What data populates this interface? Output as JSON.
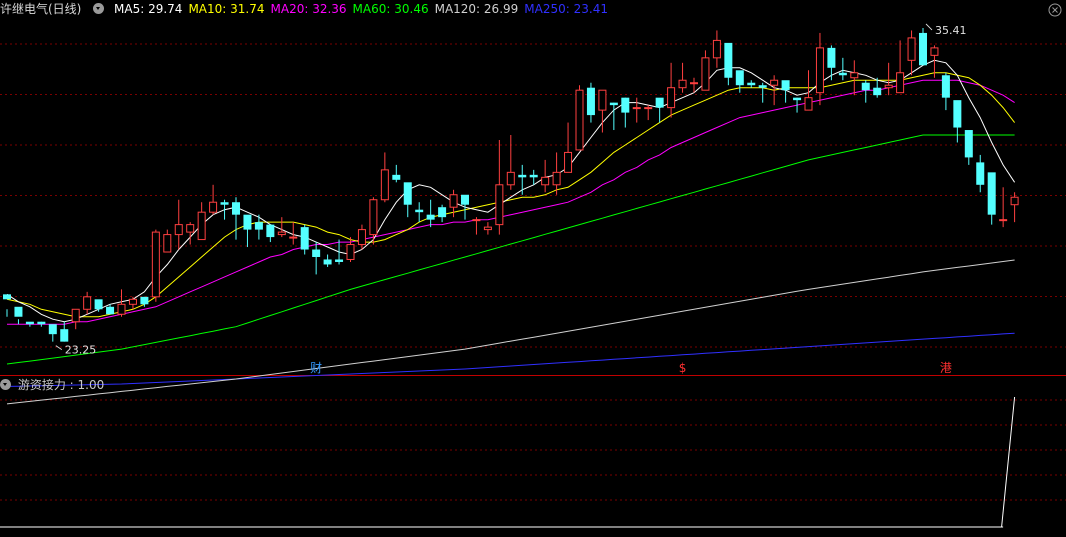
{
  "header": {
    "stock_name": "许继电气(日线)",
    "ma": [
      {
        "label": "MA5: 29.74",
        "color": "#ffffff"
      },
      {
        "label": "MA10: 31.74",
        "color": "#ffff00"
      },
      {
        "label": "MA20: 32.36",
        "color": "#ff00ff"
      },
      {
        "label": "MA60: 30.46",
        "color": "#00ff00"
      },
      {
        "label": "MA120: 26.99",
        "color": "#d0d0d0"
      },
      {
        "label": "MA250: 23.41",
        "color": "#3030ff"
      }
    ]
  },
  "indicator": {
    "label": "游资接力",
    "value_text": ": 1.00"
  },
  "annotations": {
    "high_label": "35.41",
    "low_label": "23.25",
    "markers": [
      {
        "text": "财",
        "color": "#3399ff",
        "x_index": 27
      },
      {
        "text": "$",
        "color": "#ff3030",
        "x_index": 59
      },
      {
        "text": "港",
        "color": "#ff3030",
        "x_index": 82
      }
    ]
  },
  "colors": {
    "up": "#ff4040",
    "down": "#54ffff",
    "grid": "#7a0000",
    "separator": "#c00000"
  },
  "chart_data": {
    "type": "candlestick",
    "price_range": [
      22.0,
      36.3
    ],
    "candles": [
      [
        25.2,
        25.0,
        24.6,
        24.3
      ],
      [
        24.7,
        24.3,
        24.2,
        24.0
      ],
      [
        24.1,
        24.0,
        24.0,
        23.9
      ],
      [
        24.1,
        24.0,
        24.1,
        23.9
      ],
      [
        24.0,
        23.6,
        23.9,
        23.3
      ],
      [
        23.8,
        23.3,
        24.1,
        23.3
      ],
      [
        24.1,
        24.6,
        24.6,
        23.8
      ],
      [
        24.6,
        25.1,
        25.3,
        24.4
      ],
      [
        25.0,
        24.6,
        24.9,
        24.5
      ],
      [
        24.7,
        24.4,
        24.8,
        24.4
      ],
      [
        24.4,
        24.8,
        25.4,
        24.3
      ],
      [
        24.8,
        25.0,
        25.1,
        24.6
      ],
      [
        25.1,
        24.8,
        25.1,
        24.7
      ],
      [
        25.1,
        27.7,
        27.8,
        24.9
      ],
      [
        26.9,
        27.6,
        27.8,
        26.9
      ],
      [
        27.6,
        28.0,
        29.0,
        27.0
      ],
      [
        27.7,
        28.0,
        28.1,
        27.2
      ],
      [
        27.4,
        28.5,
        28.9,
        27.4
      ],
      [
        28.5,
        28.9,
        29.6,
        28.4
      ],
      [
        28.9,
        28.8,
        29.0,
        28.2
      ],
      [
        28.9,
        28.4,
        29.1,
        27.4
      ],
      [
        28.4,
        27.8,
        28.3,
        27.1
      ],
      [
        28.1,
        27.8,
        28.4,
        27.4
      ],
      [
        28.0,
        27.5,
        28.0,
        27.3
      ],
      [
        27.6,
        27.7,
        28.3,
        27.5
      ],
      [
        27.5,
        27.5,
        28.1,
        27.2
      ],
      [
        27.9,
        27.0,
        28.0,
        26.8
      ],
      [
        27.0,
        26.7,
        27.3,
        26.0
      ],
      [
        26.6,
        26.4,
        26.8,
        26.3
      ],
      [
        26.6,
        26.5,
        27.4,
        26.4
      ],
      [
        26.6,
        27.2,
        27.5,
        26.5
      ],
      [
        27.2,
        27.8,
        28.0,
        27.0
      ],
      [
        27.6,
        29.0,
        29.1,
        27.2
      ],
      [
        29.0,
        30.2,
        30.9,
        28.9
      ],
      [
        30.0,
        29.8,
        30.4,
        29.7
      ],
      [
        29.7,
        28.8,
        29.6,
        28.3
      ],
      [
        28.6,
        28.5,
        28.9,
        28.1
      ],
      [
        28.4,
        28.2,
        29.0,
        27.9
      ],
      [
        28.7,
        28.3,
        28.8,
        28.1
      ],
      [
        28.7,
        29.2,
        29.4,
        28.3
      ],
      [
        29.2,
        28.8,
        29.1,
        28.2
      ],
      [
        28.2,
        28.2,
        28.3,
        27.6
      ],
      [
        27.8,
        27.9,
        28.1,
        27.6
      ],
      [
        28.0,
        29.6,
        31.4,
        27.6
      ],
      [
        29.6,
        30.1,
        31.6,
        29.4
      ],
      [
        30.0,
        29.9,
        30.4,
        29.2
      ],
      [
        30.0,
        29.9,
        30.2,
        29.6
      ],
      [
        29.6,
        29.9,
        30.6,
        29.3
      ],
      [
        29.6,
        30.1,
        30.9,
        29.2
      ],
      [
        30.1,
        30.9,
        32.1,
        30.1
      ],
      [
        31.0,
        33.4,
        33.6,
        31.8
      ],
      [
        33.5,
        32.4,
        33.7,
        32.1
      ],
      [
        32.6,
        33.4,
        33.2,
        31.7
      ],
      [
        32.9,
        32.8,
        32.9,
        31.8
      ],
      [
        33.1,
        32.5,
        33.1,
        31.9
      ],
      [
        32.7,
        32.7,
        33.1,
        32.1
      ],
      [
        32.7,
        32.7,
        32.8,
        32.2
      ],
      [
        33.1,
        32.7,
        32.8,
        32.1
      ],
      [
        32.7,
        33.5,
        34.5,
        32.3
      ],
      [
        33.5,
        33.8,
        34.5,
        33.3
      ],
      [
        33.7,
        33.7,
        33.9,
        33.3
      ],
      [
        33.4,
        34.7,
        35.0,
        33.5
      ],
      [
        34.7,
        35.4,
        35.8,
        34.3
      ],
      [
        35.3,
        33.9,
        34.6,
        33.6
      ],
      [
        34.2,
        33.6,
        34.1,
        33.3
      ],
      [
        33.7,
        33.6,
        33.8,
        33.5
      ],
      [
        33.6,
        33.5,
        33.7,
        32.9
      ],
      [
        33.6,
        33.8,
        34.0,
        32.8
      ],
      [
        33.8,
        33.4,
        33.6,
        32.9
      ],
      [
        33.1,
        33.0,
        33.1,
        32.5
      ],
      [
        32.6,
        33.1,
        34.2,
        32.6
      ],
      [
        33.3,
        35.1,
        35.7,
        32.8
      ],
      [
        35.1,
        34.3,
        35.2,
        33.8
      ],
      [
        34.1,
        34.0,
        34.7,
        33.8
      ],
      [
        33.9,
        34.1,
        34.6,
        33.2
      ],
      [
        33.7,
        33.4,
        33.8,
        32.9
      ],
      [
        33.5,
        33.2,
        33.9,
        33.1
      ],
      [
        33.5,
        33.6,
        34.5,
        33.2
      ],
      [
        33.3,
        34.1,
        35.4,
        33.6
      ],
      [
        34.6,
        35.5,
        35.8,
        34.0
      ],
      [
        35.7,
        34.4,
        35.9,
        34.8
      ],
      [
        34.8,
        35.1,
        35.2,
        33.9
      ],
      [
        34.0,
        33.1,
        34.1,
        32.6
      ],
      [
        33.0,
        31.9,
        32.9,
        31.3
      ],
      [
        31.8,
        30.7,
        31.5,
        30.4
      ],
      [
        30.5,
        29.6,
        30.8,
        29.3
      ],
      [
        30.1,
        28.4,
        29.8,
        28.0
      ],
      [
        28.2,
        28.2,
        29.5,
        27.9
      ],
      [
        28.8,
        29.1,
        29.3,
        28.1
      ]
    ],
    "ma_series": [
      {
        "name": "MA5",
        "color": "#ffffff",
        "values": [
          25.2,
          24.9,
          24.7,
          24.4,
          24.2,
          24.1,
          24.2,
          24.4,
          24.6,
          24.8,
          24.9,
          25.0,
          25.3,
          25.9,
          26.4,
          27.0,
          27.5,
          28.0,
          28.4,
          28.6,
          28.7,
          28.5,
          28.3,
          28.0,
          27.8,
          27.6,
          27.5,
          27.3,
          27.1,
          26.9,
          26.8,
          27.0,
          27.4,
          28.2,
          28.9,
          29.4,
          29.6,
          29.5,
          29.2,
          28.9,
          28.7,
          28.6,
          28.5,
          28.8,
          29.1,
          29.4,
          29.6,
          29.9,
          30.0,
          30.3,
          30.9,
          31.5,
          32.1,
          32.6,
          32.9,
          32.9,
          32.8,
          32.7,
          32.9,
          33.1,
          33.3,
          33.7,
          34.2,
          34.3,
          34.3,
          34.1,
          33.8,
          33.5,
          33.4,
          33.2,
          33.3,
          33.7,
          34.0,
          34.2,
          34.1,
          34.0,
          33.8,
          33.7,
          33.8,
          34.1,
          34.4,
          34.6,
          34.5,
          34.0,
          33.1,
          32.3,
          31.3,
          30.4,
          29.7
        ]
      },
      {
        "name": "MA10",
        "color": "#ffff00",
        "values": [
          25.0,
          24.9,
          24.8,
          24.6,
          24.5,
          24.4,
          24.3,
          24.3,
          24.3,
          24.4,
          24.5,
          24.6,
          24.8,
          25.1,
          25.5,
          25.9,
          26.3,
          26.7,
          27.1,
          27.5,
          27.8,
          28.0,
          28.1,
          28.1,
          28.1,
          28.1,
          28.0,
          27.9,
          27.7,
          27.6,
          27.4,
          27.3,
          27.3,
          27.4,
          27.6,
          27.8,
          28.1,
          28.3,
          28.4,
          28.5,
          28.6,
          28.7,
          28.8,
          28.9,
          29.0,
          29.1,
          29.1,
          29.2,
          29.4,
          29.5,
          29.8,
          30.1,
          30.5,
          30.9,
          31.2,
          31.5,
          31.8,
          32.1,
          32.4,
          32.6,
          32.8,
          33.0,
          33.2,
          33.4,
          33.5,
          33.5,
          33.5,
          33.4,
          33.5,
          33.5,
          33.5,
          33.5,
          33.6,
          33.7,
          33.8,
          33.8,
          33.8,
          33.8,
          33.8,
          33.9,
          34.0,
          34.1,
          34.1,
          34.0,
          33.9,
          33.6,
          33.2,
          32.7,
          32.1
        ]
      },
      {
        "name": "MA20",
        "color": "#ff00ff",
        "values": [
          24.0,
          24.0,
          24.0,
          24.0,
          24.0,
          24.0,
          24.1,
          24.1,
          24.2,
          24.3,
          24.4,
          24.5,
          24.6,
          24.7,
          24.9,
          25.1,
          25.3,
          25.5,
          25.7,
          25.9,
          26.1,
          26.3,
          26.5,
          26.7,
          26.8,
          27.0,
          27.1,
          27.2,
          27.2,
          27.3,
          27.3,
          27.4,
          27.5,
          27.6,
          27.7,
          27.8,
          27.9,
          28.0,
          28.0,
          28.1,
          28.1,
          28.2,
          28.2,
          28.3,
          28.4,
          28.5,
          28.6,
          28.7,
          28.8,
          28.9,
          29.1,
          29.3,
          29.6,
          29.8,
          30.1,
          30.3,
          30.6,
          30.8,
          31.1,
          31.3,
          31.5,
          31.7,
          31.9,
          32.1,
          32.3,
          32.4,
          32.5,
          32.6,
          32.7,
          32.8,
          32.9,
          33.0,
          33.1,
          33.2,
          33.3,
          33.4,
          33.4,
          33.5,
          33.6,
          33.7,
          33.8,
          33.8,
          33.8,
          33.8,
          33.7,
          33.6,
          33.4,
          33.2,
          32.9
        ]
      },
      {
        "name": "MA60",
        "color": "#00ff00",
        "values": [
          22.4,
          22.46,
          22.52,
          22.58,
          22.64,
          22.7,
          22.76,
          22.82,
          22.88,
          22.94,
          23.0,
          23.09,
          23.18,
          23.27,
          23.36,
          23.45,
          23.54,
          23.63,
          23.72,
          23.81,
          23.9,
          24.05,
          24.2,
          24.35,
          24.5,
          24.65,
          24.8,
          24.95,
          25.1,
          25.25,
          25.4,
          25.53,
          25.66,
          25.79,
          25.92,
          26.05,
          26.18,
          26.31,
          26.44,
          26.57,
          26.7,
          26.83,
          26.96,
          27.09,
          27.22,
          27.35,
          27.48,
          27.61,
          27.74,
          27.87,
          28.0,
          28.13,
          28.26,
          28.39,
          28.52,
          28.65,
          28.78,
          28.91,
          29.04,
          29.17,
          29.3,
          29.43,
          29.56,
          29.69,
          29.82,
          29.95,
          30.08,
          30.21,
          30.34,
          30.47,
          30.6,
          30.7,
          30.8,
          30.9,
          31.0,
          31.1,
          31.2,
          31.3,
          31.4,
          31.5,
          31.6,
          31.6,
          31.6,
          31.6,
          31.6,
          31.6,
          31.6,
          31.6,
          31.6
        ]
      },
      {
        "name": "MA120",
        "color": "#d0d0d0",
        "values": [
          20.8,
          20.85,
          20.9,
          20.95,
          21.0,
          21.05,
          21.1,
          21.15,
          21.2,
          21.25,
          21.3,
          21.35,
          21.4,
          21.45,
          21.5,
          21.55,
          21.6,
          21.65,
          21.7,
          21.75,
          21.8,
          21.86,
          21.92,
          21.98,
          22.04,
          22.1,
          22.16,
          22.22,
          22.28,
          22.34,
          22.4,
          22.46,
          22.52,
          22.58,
          22.64,
          22.7,
          22.76,
          22.82,
          22.88,
          22.94,
          23.0,
          23.08,
          23.16,
          23.24,
          23.32,
          23.4,
          23.48,
          23.56,
          23.64,
          23.72,
          23.8,
          23.88,
          23.96,
          24.04,
          24.12,
          24.2,
          24.28,
          24.36,
          24.44,
          24.52,
          24.6,
          24.68,
          24.76,
          24.84,
          24.92,
          25.0,
          25.08,
          25.16,
          25.24,
          25.32,
          25.4,
          25.47,
          25.54,
          25.61,
          25.68,
          25.75,
          25.82,
          25.89,
          25.96,
          26.03,
          26.1,
          26.16,
          26.22,
          26.28,
          26.34,
          26.4,
          26.46,
          26.52,
          26.58
        ]
      },
      {
        "name": "MA250",
        "color": "#3030ff",
        "values": [
          21.5,
          21.51,
          21.52,
          21.53,
          21.54,
          21.55,
          21.56,
          21.57,
          21.58,
          21.59,
          21.6,
          21.62,
          21.64,
          21.66,
          21.68,
          21.7,
          21.72,
          21.74,
          21.76,
          21.78,
          21.8,
          21.82,
          21.84,
          21.86,
          21.88,
          21.9,
          21.92,
          21.94,
          21.96,
          21.98,
          22.0,
          22.02,
          22.04,
          22.06,
          22.08,
          22.1,
          22.12,
          22.14,
          22.16,
          22.18,
          22.2,
          22.23,
          22.26,
          22.29,
          22.32,
          22.35,
          22.38,
          22.41,
          22.44,
          22.47,
          22.5,
          22.53,
          22.56,
          22.59,
          22.62,
          22.65,
          22.68,
          22.71,
          22.74,
          22.77,
          22.8,
          22.83,
          22.86,
          22.89,
          22.92,
          22.95,
          22.98,
          23.01,
          23.04,
          23.07,
          23.1,
          23.13,
          23.16,
          23.19,
          23.22,
          23.25,
          23.28,
          23.31,
          23.34,
          23.37,
          23.4,
          23.43,
          23.46,
          23.49,
          23.52,
          23.55,
          23.58,
          23.61,
          23.64
        ]
      }
    ],
    "indicator_series": {
      "name": "游资接力",
      "range": [
        0,
        1
      ],
      "values": [
        0,
        0,
        0,
        0,
        0,
        0,
        0,
        0,
        0,
        0,
        0,
        0,
        0,
        0,
        0,
        0,
        0,
        0,
        0,
        0,
        0,
        0,
        0,
        0,
        0,
        0,
        0,
        0,
        0,
        0,
        0,
        0,
        0,
        0,
        0,
        0,
        0,
        0,
        0,
        0,
        0,
        0,
        0,
        0,
        0,
        0,
        0,
        0,
        0,
        0,
        0,
        0,
        0,
        0,
        0,
        0,
        0,
        0,
        0,
        0,
        0,
        0,
        0,
        0,
        0,
        0,
        0,
        0,
        0,
        0,
        0,
        0,
        0,
        0,
        0,
        0,
        0,
        0,
        0,
        0,
        0,
        0,
        0,
        0,
        0,
        0,
        0,
        0,
        1
      ]
    }
  }
}
